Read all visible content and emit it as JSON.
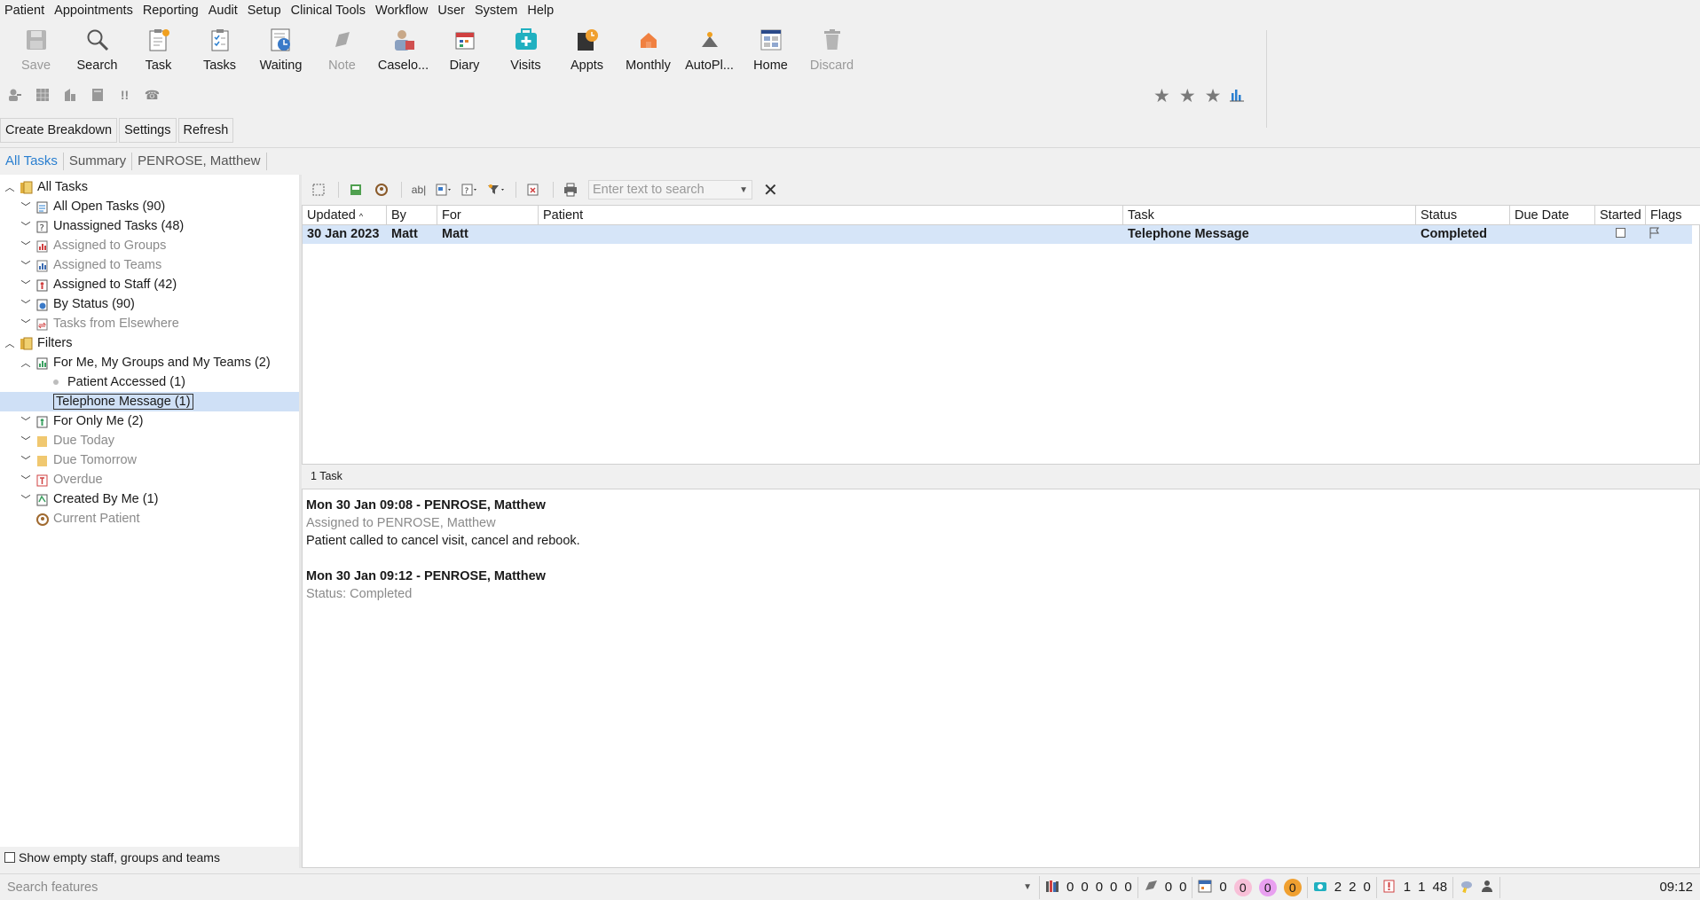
{
  "menu": [
    "Patient",
    "Appointments",
    "Reporting",
    "Audit",
    "Setup",
    "Clinical Tools",
    "Workflow",
    "User",
    "System",
    "Help"
  ],
  "toolbar": [
    {
      "label": "Save",
      "icon": "save-icon",
      "enabled": false
    },
    {
      "label": "Search",
      "icon": "search-icon",
      "enabled": true
    },
    {
      "label": "Task",
      "icon": "task-icon",
      "enabled": true
    },
    {
      "label": "Tasks",
      "icon": "tasks-icon",
      "enabled": true
    },
    {
      "label": "Waiting",
      "icon": "waiting-icon",
      "enabled": true
    },
    {
      "label": "Note",
      "icon": "note-icon",
      "enabled": false
    },
    {
      "label": "Caselo...",
      "icon": "caseload-icon",
      "enabled": true
    },
    {
      "label": "Diary",
      "icon": "diary-icon",
      "enabled": true
    },
    {
      "label": "Visits",
      "icon": "visits-icon",
      "enabled": true
    },
    {
      "label": "Appts",
      "icon": "appts-icon",
      "enabled": true
    },
    {
      "label": "Monthly",
      "icon": "monthly-icon",
      "enabled": true
    },
    {
      "label": "AutoPl...",
      "icon": "autoplan-icon",
      "enabled": true
    },
    {
      "label": "Home",
      "icon": "home-icon",
      "enabled": true
    },
    {
      "label": "Discard",
      "icon": "discard-icon",
      "enabled": false
    }
  ],
  "actions": {
    "create_breakdown": "Create Breakdown",
    "settings": "Settings",
    "refresh": "Refresh"
  },
  "tabs": {
    "all_tasks": "All Tasks",
    "summary": "Summary",
    "patient": "PENROSE, Matthew"
  },
  "tree": {
    "all_tasks": "All Tasks",
    "all_open": "All Open Tasks (90)",
    "unassigned": "Unassigned Tasks (48)",
    "groups": "Assigned to Groups",
    "teams": "Assigned to Teams",
    "staff": "Assigned to Staff (42)",
    "by_status": "By Status (90)",
    "elsewhere": "Tasks from Elsewhere",
    "filters": "Filters",
    "for_me_groups": "For Me, My Groups and My Teams (2)",
    "patient_accessed": "Patient Accessed (1)",
    "telephone": "Telephone Message (1)",
    "only_me": "For Only Me (2)",
    "due_today": "Due Today",
    "due_tomorrow": "Due Tomorrow",
    "overdue": "Overdue",
    "created_by_me": "Created By Me (1)",
    "current_patient": "Current Patient"
  },
  "show_empty": "Show empty staff, groups and teams",
  "search": {
    "placeholder": "Enter text to search"
  },
  "grid": {
    "headers": {
      "updated": "Updated",
      "by": "By",
      "for": "For",
      "patient": "Patient",
      "task": "Task",
      "status": "Status",
      "due": "Due Date",
      "started": "Started",
      "flags": "Flags"
    },
    "rows": [
      {
        "updated": "30 Jan 2023",
        "by": "Matt",
        "for": "Matt",
        "patient": "",
        "task": "Telephone Message",
        "status": "Completed",
        "due": ""
      }
    ]
  },
  "count": "1 Task",
  "detail": {
    "h1": "Mon 30 Jan 09:08 - PENROSE, Matthew",
    "l1": "Assigned to PENROSE, Matthew",
    "l2": "Patient called to cancel visit, cancel and rebook.",
    "h2": "Mon 30 Jan 09:12 - PENROSE, Matthew",
    "l3": "Status: Completed"
  },
  "status": {
    "search_placeholder": "Search features",
    "g1": [
      "0",
      "0",
      "0",
      "0",
      "0"
    ],
    "g2": [
      "0",
      "0"
    ],
    "g3": "0",
    "circles": [
      "0",
      "0",
      "0"
    ],
    "g4": [
      "2",
      "2",
      "0"
    ],
    "g5": [
      "1",
      "1",
      "48"
    ],
    "clock": "09:12"
  }
}
